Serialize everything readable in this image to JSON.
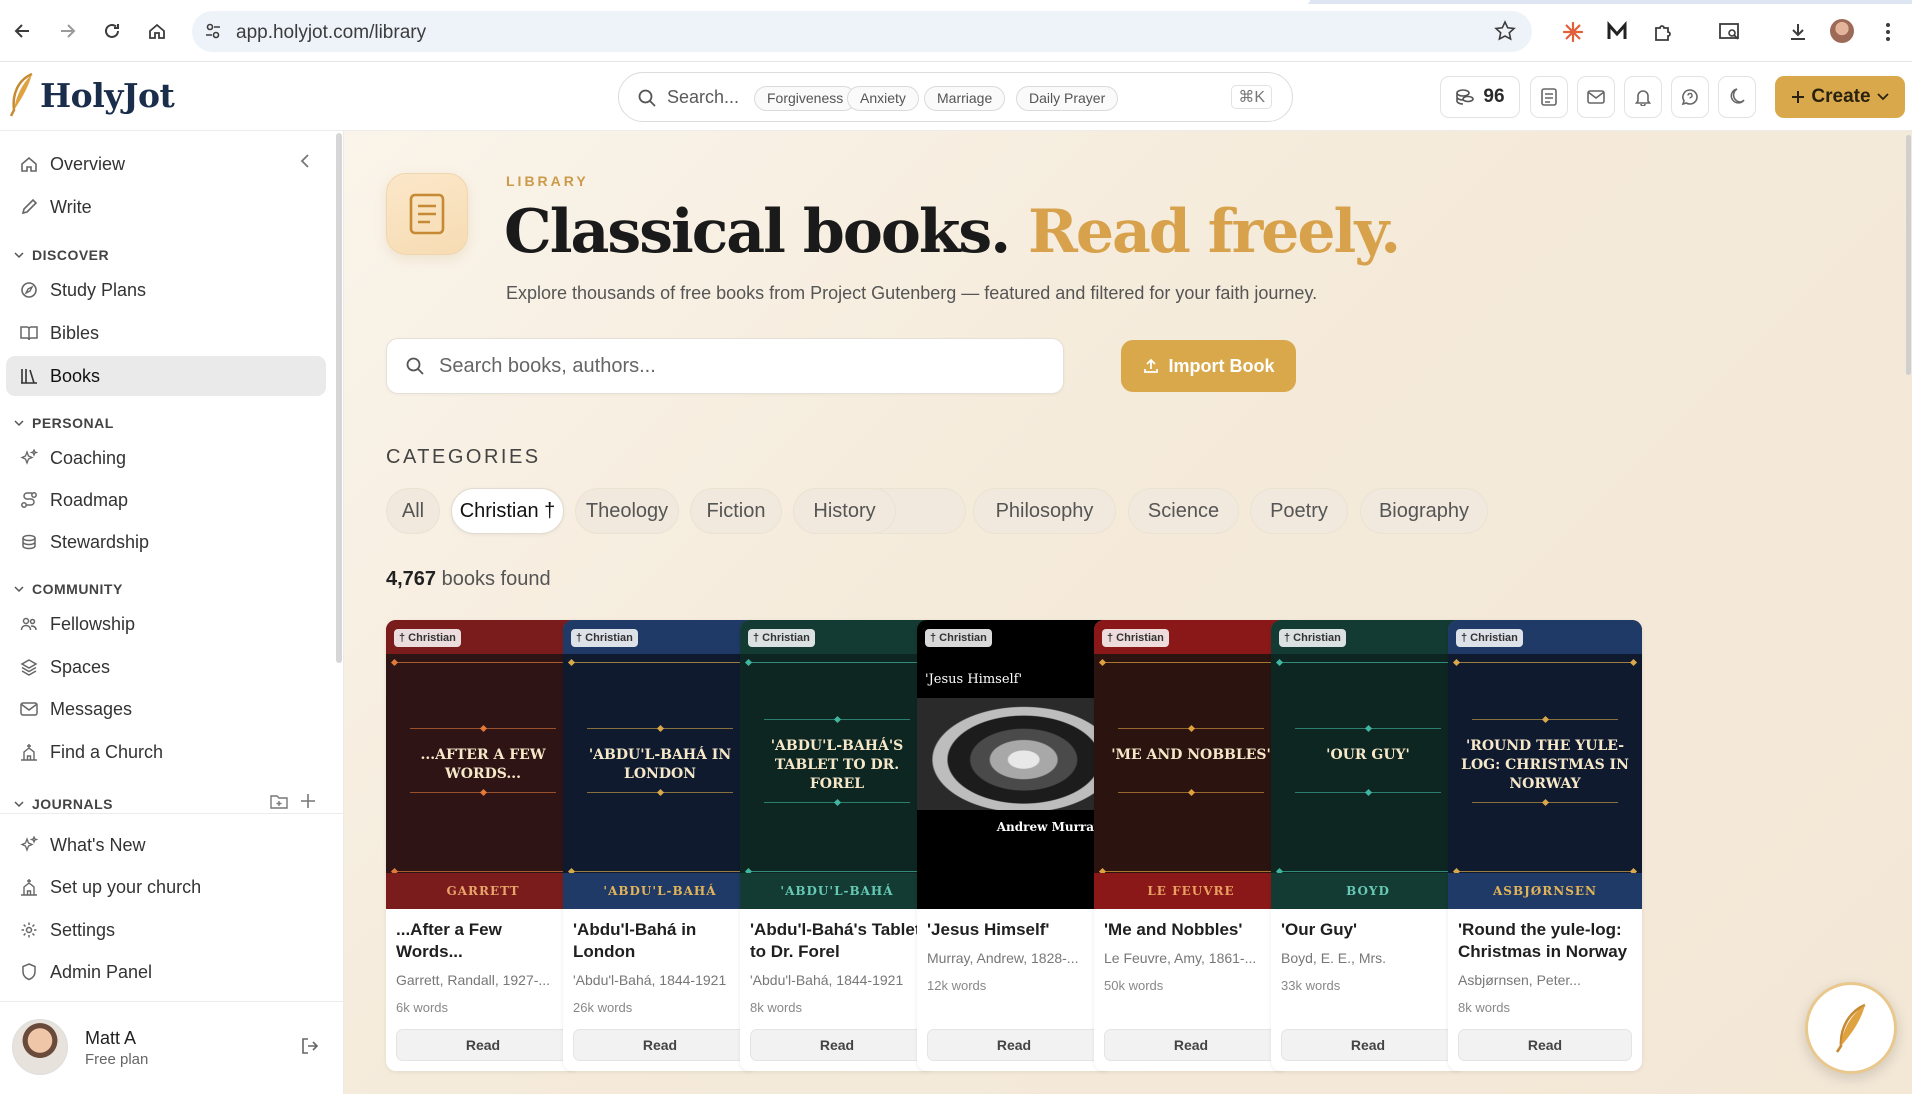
{
  "browser": {
    "url": "app.holyjot.com/library"
  },
  "header": {
    "brand": "HolyJot",
    "search_placeholder": "Search...",
    "search_chips": [
      "Forgiveness",
      "Anxiety",
      "Marriage",
      "Daily Prayer"
    ],
    "shortcut": "⌘K",
    "credits": "96",
    "create_label": "Create"
  },
  "sidebar": {
    "top": [
      {
        "label": "Overview",
        "icon": "home-icon"
      },
      {
        "label": "Write",
        "icon": "pen-icon"
      }
    ],
    "discover_title": "DISCOVER",
    "discover": [
      {
        "label": "Study Plans",
        "icon": "compass-icon"
      },
      {
        "label": "Bibles",
        "icon": "open-book-icon"
      },
      {
        "label": "Books",
        "icon": "library-icon",
        "active": true
      }
    ],
    "personal_title": "PERSONAL",
    "personal": [
      {
        "label": "Coaching",
        "icon": "sparkles-icon"
      },
      {
        "label": "Roadmap",
        "icon": "route-icon"
      },
      {
        "label": "Stewardship",
        "icon": "coins-icon"
      }
    ],
    "community_title": "COMMUNITY",
    "community": [
      {
        "label": "Fellowship",
        "icon": "people-icon"
      },
      {
        "label": "Spaces",
        "icon": "layers-icon"
      },
      {
        "label": "Messages",
        "icon": "mail-icon"
      },
      {
        "label": "Find a Church",
        "icon": "church-icon"
      }
    ],
    "journals_title": "JOURNALS",
    "bottom": [
      {
        "label": "What's New",
        "icon": "sparkles-icon"
      },
      {
        "label": "Set up your church",
        "icon": "church-icon"
      },
      {
        "label": "Settings",
        "icon": "gear-icon"
      },
      {
        "label": "Admin Panel",
        "icon": "shield-icon"
      }
    ],
    "user": {
      "name": "Matt A",
      "plan": "Free plan"
    }
  },
  "main": {
    "eyebrow": "LIBRARY",
    "headline_a": "Classical books.",
    "headline_b": "Read freely.",
    "subtitle": "Explore thousands of free books from Project Gutenberg — featured and filtered for your faith journey.",
    "search_placeholder": "Search books, authors...",
    "import_label": "Import Book",
    "categories_title": "CATEGORIES",
    "categories": [
      "All",
      "Christian †",
      "Theology",
      "Fiction",
      "History",
      "Philosophy",
      "Science",
      "Poetry",
      "Biography"
    ],
    "selected_category": "Christian †",
    "count_number": "4,767",
    "count_label": "books found",
    "read_label": "Read",
    "books": [
      {
        "tag": "† Christian",
        "cover_title": "...After a Few Words...",
        "cover_author": "GARRETT",
        "title": "...After a Few Words...",
        "author": "Garrett, Randall, 1927-...",
        "words": "6k words",
        "bg": "#2e1414",
        "band": "#7a1c1c",
        "accent": "#e07a3a",
        "author_color": "#e9a36a"
      },
      {
        "tag": "† Christian",
        "cover_title": "'Abdu'l-Bahá in London",
        "cover_author": "'ABDU'L-BAHÁ",
        "title": "'Abdu'l-Bahá in London",
        "author": "'Abdu'l-Bahá, 1844-1921",
        "words": "26k words",
        "bg": "#0f1a2e",
        "band": "#1f3a66",
        "accent": "#d9a84a",
        "author_color": "#e2b45a"
      },
      {
        "tag": "† Christian",
        "cover_title": "'Abdu'l-Bahá's Tablet to Dr. Forel",
        "cover_author": "'ABDU'L-BAHÁ",
        "title": "'Abdu'l-Bahá's Tablet to Dr. Forel",
        "author": "'Abdu'l-Bahá, 1844-1921",
        "words": "8k words",
        "bg": "#0e2622",
        "band": "#133a33",
        "accent": "#3fb7a0",
        "author_color": "#65c9b3"
      },
      {
        "tag": "† Christian",
        "cover_title": "'Jesus Himself'",
        "cover_author": "Andrew Murray",
        "title": "'Jesus Himself'",
        "author": "Murray, Andrew, 1828-...",
        "words": "12k words",
        "bg": "#000000",
        "band": "#000000",
        "accent": "#ffffff",
        "author_color": "#ffffff",
        "photo": true
      },
      {
        "tag": "† Christian",
        "cover_title": "'Me and Nobbles'",
        "cover_author": "LE FEUVRE",
        "title": "'Me and Nobbles'",
        "author": "Le Feuvre, Amy, 1861-...",
        "words": "50k words",
        "bg": "#2b1410",
        "band": "#8a1818",
        "accent": "#e0a040",
        "author_color": "#e9a060"
      },
      {
        "tag": "† Christian",
        "cover_title": "'Our Guy'",
        "cover_author": "BOYD",
        "title": "'Our Guy'",
        "author": "Boyd, E. E., Mrs.",
        "words": "33k words",
        "bg": "#0e2622",
        "band": "#133a33",
        "accent": "#3fb7a0",
        "author_color": "#65c9b3"
      },
      {
        "tag": "† Christian",
        "cover_title": "'Round the yule-log: Christmas in Norway",
        "cover_author": "ASBJØRNSEN",
        "title": "'Round the yule-log: Christmas in Norway",
        "author": "Asbjørnsen, Peter...",
        "words": "8k words",
        "bg": "#0f1a2e",
        "band": "#1f3a66",
        "accent": "#d9a84a",
        "author_color": "#e2b45a"
      }
    ]
  },
  "colors": {
    "accent": "#d9a84a",
    "brand_navy": "#1a2e4c"
  }
}
